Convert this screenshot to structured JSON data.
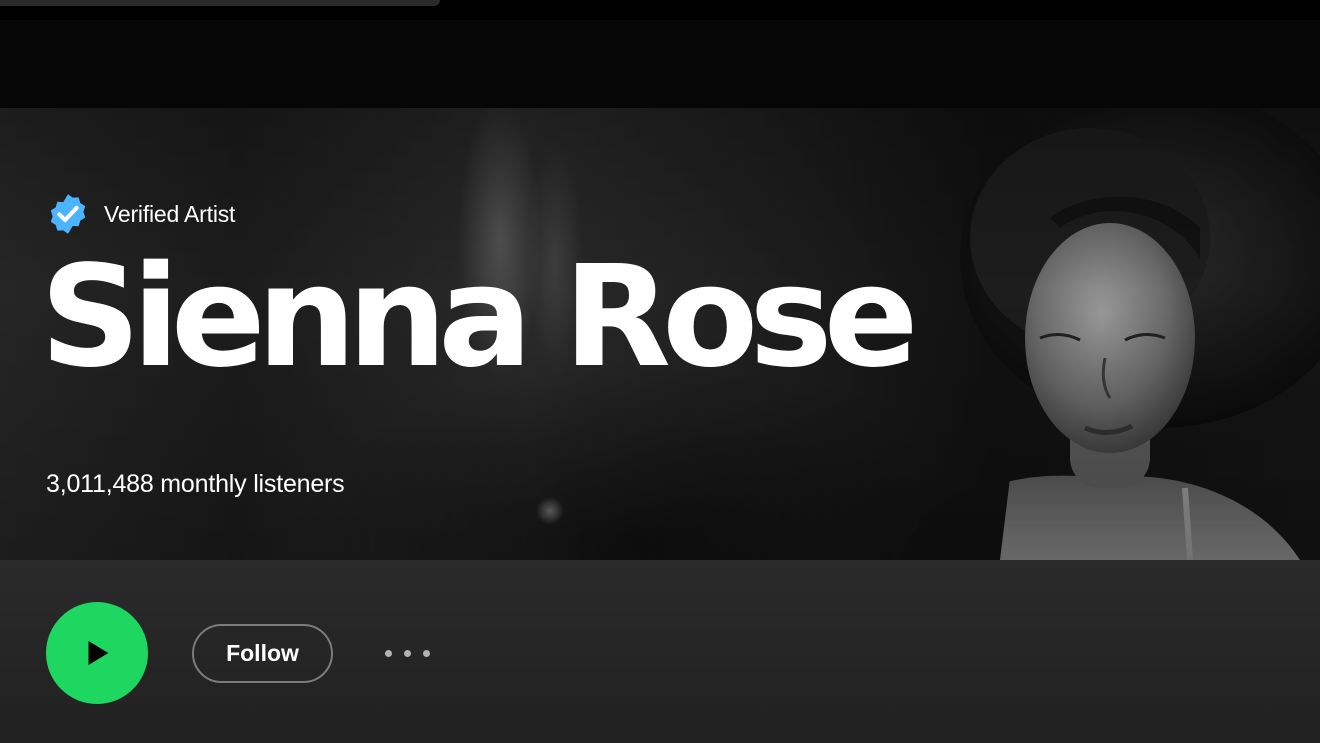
{
  "artist": {
    "verified_label": "Verified Artist",
    "name": "Sienna Rose",
    "monthly_listeners": "3,011,488 monthly listeners"
  },
  "actions": {
    "follow_label": "Follow"
  },
  "icons": {
    "verified": "verified-badge-icon",
    "play": "play-icon",
    "more": "more-options-icon"
  },
  "colors": {
    "accent_green": "#1ed760",
    "verified_blue": "#4cb3ff",
    "background": "#121212",
    "text": "#ffffff"
  }
}
